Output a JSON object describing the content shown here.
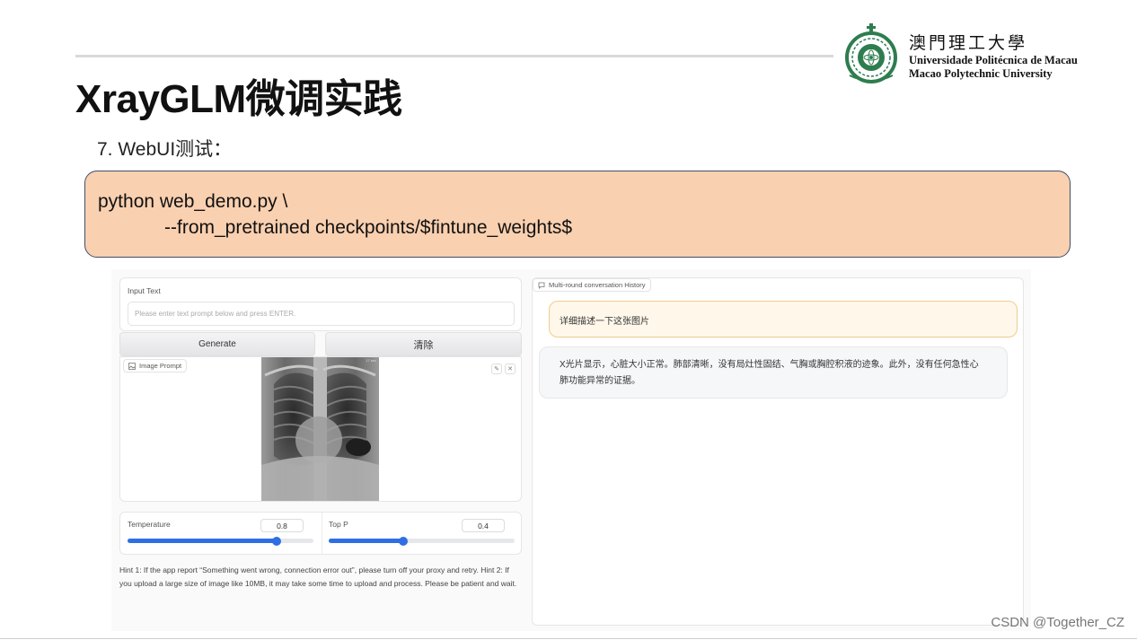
{
  "slide": {
    "title": "XrayGLM微调实践",
    "subtitle": "7. WebUI测试："
  },
  "university": {
    "name_cn": "澳門理工大學",
    "name_pt": "Universidade Politécnica de Macau",
    "name_en": "Macao Polytechnic University"
  },
  "code": {
    "line1": "python web_demo.py \\",
    "line2": "--from_pretrained checkpoints/$fintune_weights$"
  },
  "webui": {
    "input_label": "Input Text",
    "input_placeholder": "Please enter text prompt below and press ENTER.",
    "generate_label": "Generate",
    "clear_label": "清除",
    "image_prompt_label": "Image Prompt",
    "xray_corner_text": "17 sec",
    "temperature": {
      "label": "Temperature",
      "value": "0.8",
      "fraction": 0.8
    },
    "top_p": {
      "label": "Top P",
      "value": "0.4",
      "fraction": 0.4
    },
    "hint": "Hint 1: If the app report “Something went wrong, connection error out”, please turn off your proxy and retry. Hint 2: If you upload a large size of image like 10MB, it may take some time to upload and process. Please be patient and wait.",
    "history_label": "Multi-round conversation History",
    "user_message": "详细描述一下这张图片",
    "bot_message": "X光片显示，心脏大小正常。肺部清晰，没有局灶性固结、气胸或胸腔积液的迹象。此外，没有任何急性心肺功能异常的证据。"
  },
  "watermark": "CSDN @Together_CZ",
  "colors": {
    "code_bg": "#f9d0b0",
    "code_border": "#3f4f6b",
    "slider": "#2f6fe4",
    "user_bubble": "#fff7ea",
    "logo_green": "#2e7d4f"
  },
  "icons": {
    "image": "image-icon",
    "edit": "pencil-icon",
    "close": "close-icon",
    "chat": "chat-icon",
    "logo": "university-seal-icon"
  }
}
